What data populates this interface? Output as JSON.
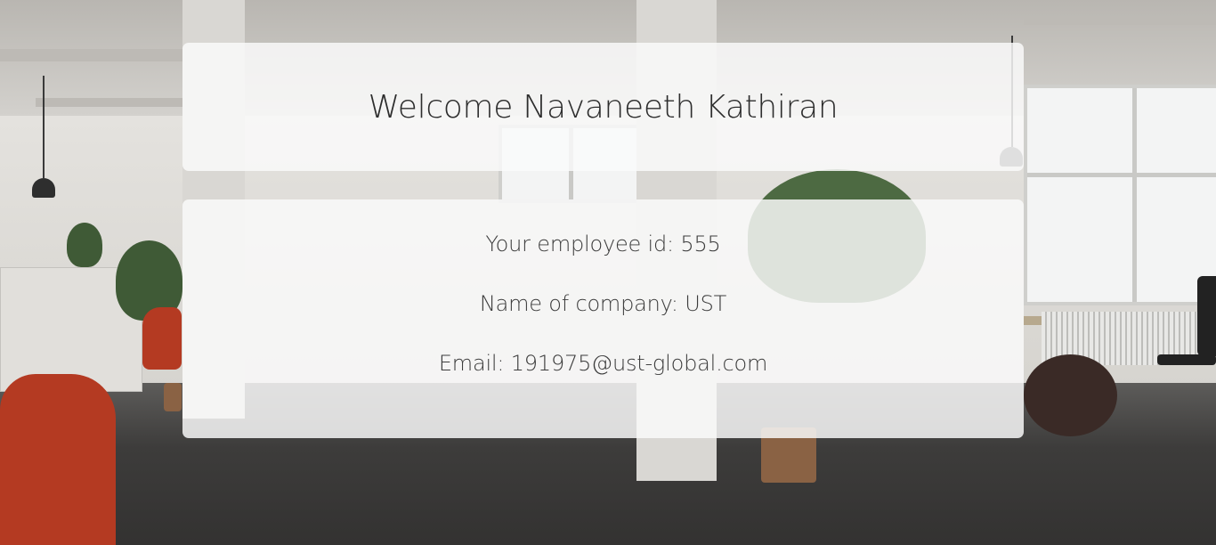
{
  "welcome": {
    "prefix": "Welcome",
    "name": "Navaneeth Kathiran"
  },
  "details": {
    "employee_id_label": "Your employee id:",
    "employee_id": "555",
    "company_label": "Name of company:",
    "company": "UST",
    "email_label": "Email:",
    "email": "191975@ust-global.com"
  },
  "colors": {
    "panel": "#fafafa",
    "text": "#2d2d2d"
  }
}
